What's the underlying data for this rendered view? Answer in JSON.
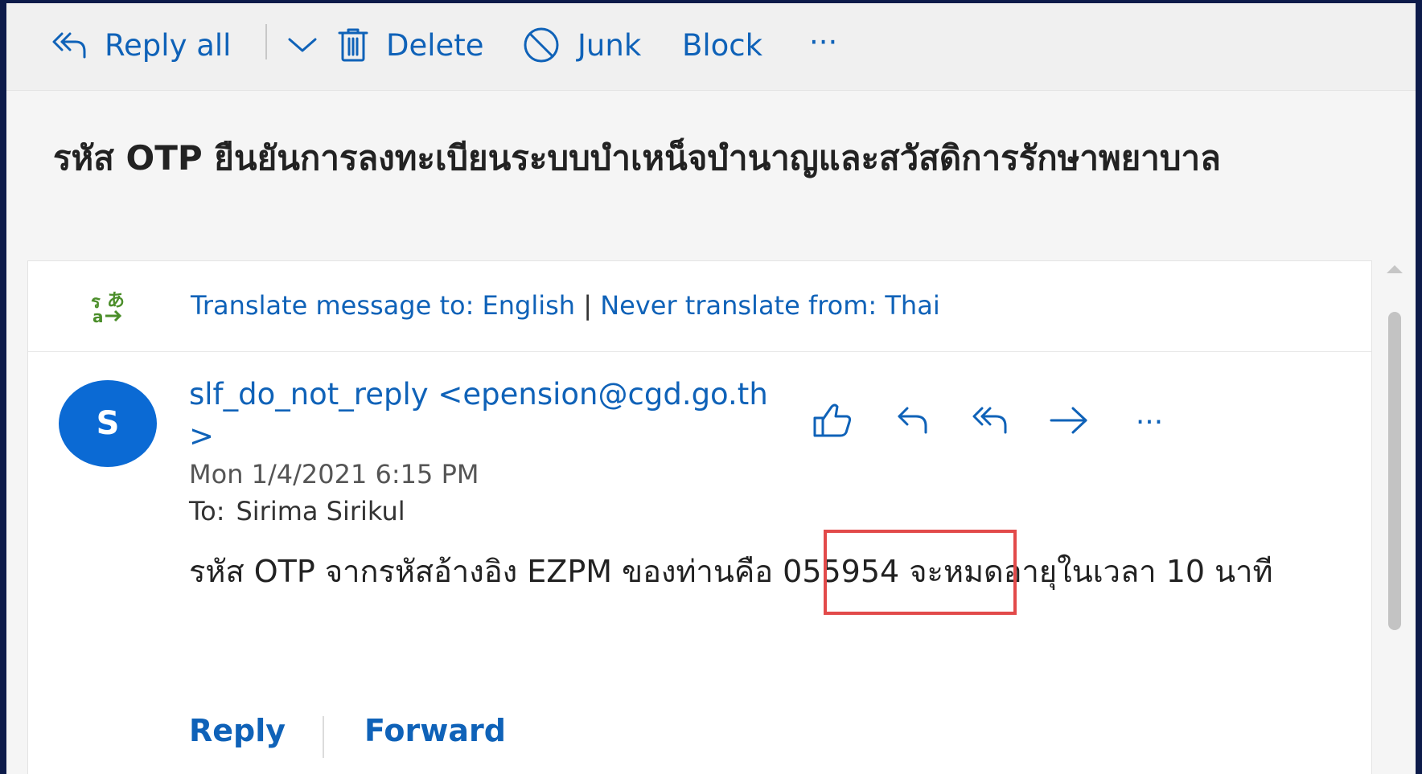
{
  "toolbar": {
    "reply_all": "Reply all",
    "delete": "Delete",
    "junk": "Junk",
    "block": "Block",
    "more": "···"
  },
  "subject": "รหัส OTP ยืนยันการลงทะเบียนระบบบำเหน็จบำนาญและสวัสดิการรักษาพยาบาล",
  "translate": {
    "translate_to": "Translate message to: English",
    "separator": "|",
    "never_translate": "Never translate from: Thai"
  },
  "message": {
    "avatar_initial": "S",
    "sender": "slf_do_not_reply <epension@cgd.go.th>",
    "date": "Mon 1/4/2021 6:15 PM",
    "to_label": "To:",
    "to_value": "Sirima Sirikul",
    "body": "รหัส OTP จากรหัสอ้างอิง EZPM ของท่านคือ 055954 จะหมดอายุในเวลา 10 นาที",
    "more": "···"
  },
  "footer": {
    "reply": "Reply",
    "forward": "Forward"
  },
  "colors": {
    "accent": "#0f62b8",
    "avatar": "#0b6ad4",
    "highlight": "#e24a4a",
    "border": "#0d1b4a"
  }
}
